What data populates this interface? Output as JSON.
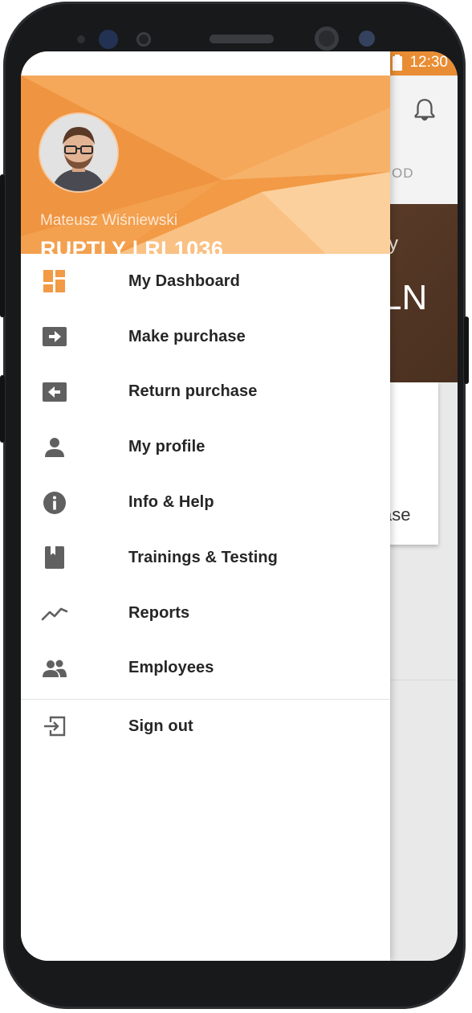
{
  "status_bar": {
    "time": "12:30",
    "icons": [
      "wifi-icon",
      "signal-icon",
      "battery-icon"
    ],
    "color": "#e98d34"
  },
  "background_app": {
    "tab_fragment": "OD",
    "banner_small": "y",
    "banner_big": "LN",
    "card_fragment": "ase",
    "icons": [
      "bell-icon"
    ]
  },
  "drawer": {
    "user": {
      "name": "Mateusz Wiśniewski",
      "company": "RUPTLY |  RL1036"
    },
    "accent": "#f29a45",
    "menu": [
      {
        "label": "My Dashboard",
        "icon": "dashboard-icon"
      },
      {
        "label": "Make purchase",
        "icon": "arrow-right-box-icon"
      },
      {
        "label": "Return purchase",
        "icon": "arrow-left-box-icon"
      },
      {
        "label": "My profile",
        "icon": "person-icon"
      },
      {
        "label": "Info & Help",
        "icon": "info-icon"
      },
      {
        "label": "Trainings & Testing",
        "icon": "book-icon"
      },
      {
        "label": "Reports",
        "icon": "trending-icon"
      },
      {
        "label": "Employees",
        "icon": "people-icon"
      }
    ],
    "sign_out": {
      "label": "Sign out",
      "icon": "exit-icon"
    }
  }
}
